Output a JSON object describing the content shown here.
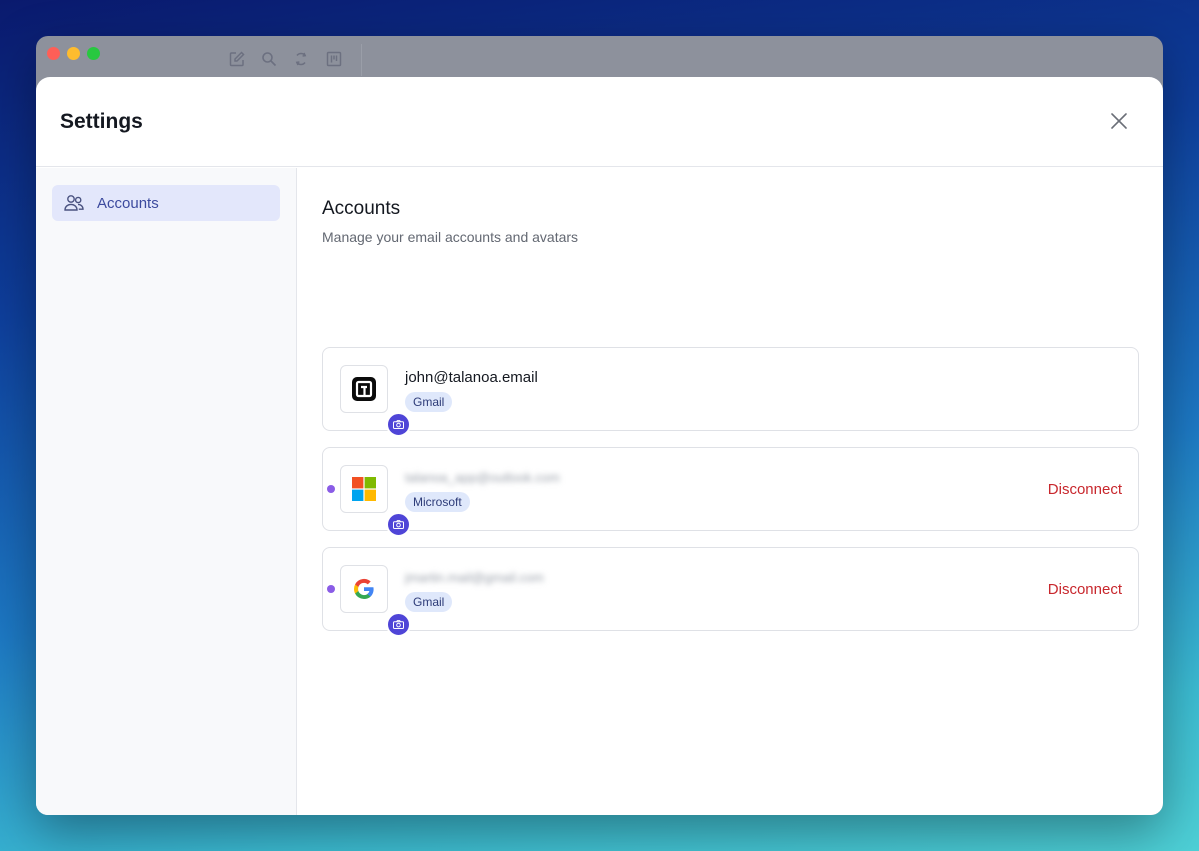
{
  "window": {
    "toolbar_icons": [
      "compose-icon",
      "search-icon",
      "sync-icon",
      "kanban-icon"
    ]
  },
  "modal": {
    "title": "Settings",
    "close_icon": "close-icon"
  },
  "sidebar": {
    "items": [
      {
        "label": "Accounts",
        "icon": "users-icon",
        "active": true
      }
    ]
  },
  "main": {
    "title": "Accounts",
    "subtitle": "Manage your email accounts and avatars",
    "accounts": [
      {
        "email": "john@talanoa.email",
        "provider": "Gmail",
        "logo": "talanoa-logo",
        "indicator": false,
        "action": ""
      },
      {
        "email": "talanoa_app@outlook.com",
        "provider": "Microsoft",
        "logo": "microsoft-logo",
        "indicator": true,
        "action": "Disconnect"
      },
      {
        "email": "jmartin.mail@gmail.com",
        "provider": "Gmail",
        "logo": "google-logo",
        "indicator": true,
        "action": "Disconnect"
      }
    ]
  },
  "colors": {
    "accent": "#4f45d7",
    "sidebar_active_bg": "#e3e7fb",
    "badge_bg": "#dfe8fb",
    "danger": "#c8272d",
    "indicator": "#8a5ce6"
  }
}
